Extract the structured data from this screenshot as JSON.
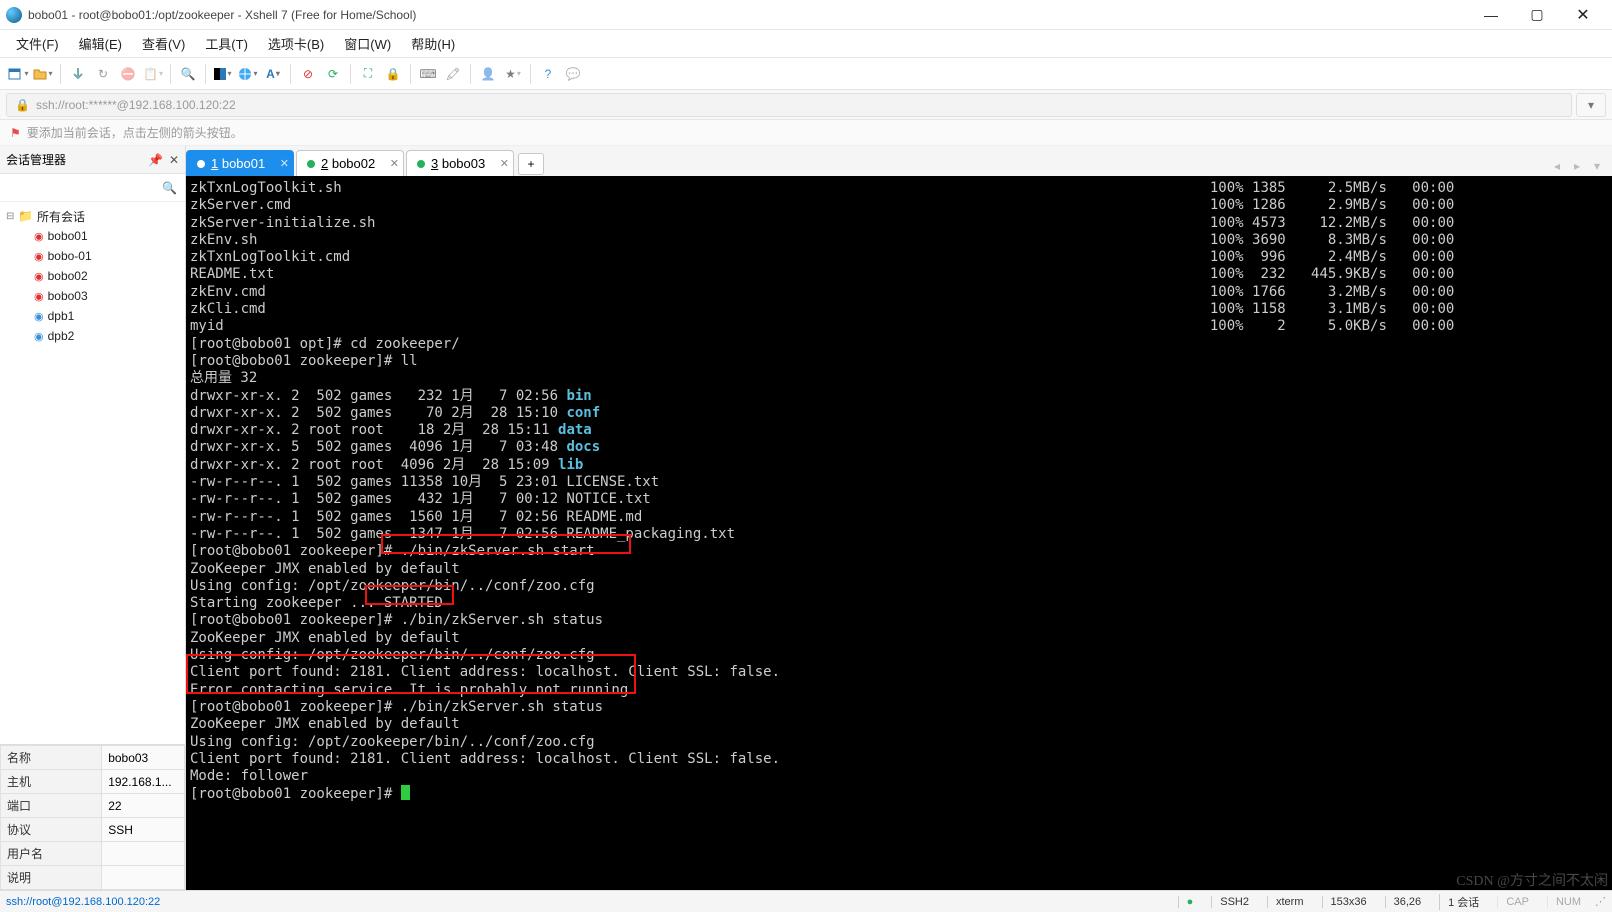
{
  "window": {
    "title": "bobo01 - root@bobo01:/opt/zookeeper - Xshell 7 (Free for Home/School)"
  },
  "menu": {
    "items": [
      "文件(F)",
      "编辑(E)",
      "查看(V)",
      "工具(T)",
      "选项卡(B)",
      "窗口(W)",
      "帮助(H)"
    ]
  },
  "address": {
    "url": "ssh://root:******@192.168.100.120:22"
  },
  "hint": {
    "text": "要添加当前会话，点击左侧的箭头按钮。"
  },
  "sidebar": {
    "title": "会话管理器",
    "root": "所有会话",
    "sessions": [
      {
        "name": "bobo01",
        "color": "red"
      },
      {
        "name": "bobo-01",
        "color": "red"
      },
      {
        "name": "bobo02",
        "color": "red"
      },
      {
        "name": "bobo03",
        "color": "red"
      },
      {
        "name": "dpb1",
        "color": "blue"
      },
      {
        "name": "dpb2",
        "color": "blue"
      }
    ]
  },
  "props": {
    "rows": [
      {
        "k": "名称",
        "v": "bobo03"
      },
      {
        "k": "主机",
        "v": "192.168.1..."
      },
      {
        "k": "端口",
        "v": "22"
      },
      {
        "k": "协议",
        "v": "SSH"
      },
      {
        "k": "用户名",
        "v": ""
      },
      {
        "k": "说明",
        "v": ""
      }
    ]
  },
  "tabs": {
    "items": [
      {
        "label": "1 bobo01",
        "active": true
      },
      {
        "label": "2 bobo02",
        "active": false
      },
      {
        "label": "3 bobo03",
        "active": false
      }
    ]
  },
  "terminal": {
    "transfer": [
      {
        "name": "zkTxnLogToolkit.sh",
        "pct": "100%",
        "size": "1385",
        "speed": "2.5MB/s",
        "eta": "00:00"
      },
      {
        "name": "zkServer.cmd",
        "pct": "100%",
        "size": "1286",
        "speed": "2.9MB/s",
        "eta": "00:00"
      },
      {
        "name": "zkServer-initialize.sh",
        "pct": "100%",
        "size": "4573",
        "speed": "12.2MB/s",
        "eta": "00:00"
      },
      {
        "name": "zkEnv.sh",
        "pct": "100%",
        "size": "3690",
        "speed": "8.3MB/s",
        "eta": "00:00"
      },
      {
        "name": "zkTxnLogToolkit.cmd",
        "pct": "100%",
        "size": "996",
        "speed": "2.4MB/s",
        "eta": "00:00"
      },
      {
        "name": "README.txt",
        "pct": "100%",
        "size": "232",
        "speed": "445.9KB/s",
        "eta": "00:00"
      },
      {
        "name": "zkEnv.cmd",
        "pct": "100%",
        "size": "1766",
        "speed": "3.2MB/s",
        "eta": "00:00"
      },
      {
        "name": "zkCli.cmd",
        "pct": "100%",
        "size": "1158",
        "speed": "3.1MB/s",
        "eta": "00:00"
      },
      {
        "name": "myid",
        "pct": "100%",
        "size": "2",
        "speed": "5.0KB/s",
        "eta": "00:00"
      }
    ],
    "body": [
      "[root@bobo01 opt]# cd zookeeper/",
      "[root@bobo01 zookeeper]# ll",
      "总用量 32",
      {
        "text": "drwxr-xr-x. 2  502 games   232 1月   7 02:56 ",
        "dir": "bin"
      },
      {
        "text": "drwxr-xr-x. 2  502 games    70 2月  28 15:10 ",
        "dir": "conf"
      },
      {
        "text": "drwxr-xr-x. 2 root root    18 2月  28 15:11 ",
        "dir": "data"
      },
      {
        "text": "drwxr-xr-x. 5  502 games  4096 1月   7 03:48 ",
        "dir": "docs"
      },
      {
        "text": "drwxr-xr-x. 2 root root  4096 2月  28 15:09 ",
        "dir": "lib"
      },
      "-rw-r--r--. 1  502 games 11358 10月  5 23:01 LICENSE.txt",
      "-rw-r--r--. 1  502 games   432 1月   7 00:12 NOTICE.txt",
      "-rw-r--r--. 1  502 games  1560 1月   7 02:56 README.md",
      "-rw-r--r--. 1  502 games  1347 1月   7 02:56 README_packaging.txt",
      "[root@bobo01 zookeeper]# ./bin/zkServer.sh start",
      "ZooKeeper JMX enabled by default",
      "Using config: /opt/zookeeper/bin/../conf/zoo.cfg",
      "Starting zookeeper ... STARTED",
      "[root@bobo01 zookeeper]# ./bin/zkServer.sh status",
      "ZooKeeper JMX enabled by default",
      "Using config: /opt/zookeeper/bin/../conf/zoo.cfg",
      "Client port found: 2181. Client address: localhost. Client SSL: false.",
      "Error contacting service. It is probably not running.",
      "[root@bobo01 zookeeper]# ./bin/zkServer.sh status",
      "ZooKeeper JMX enabled by default",
      "Using config: /opt/zookeeper/bin/../conf/zoo.cfg",
      "Client port found: 2181. Client address: localhost. Client SSL: false.",
      "Mode: follower",
      "[root@bobo01 zookeeper]# "
    ]
  },
  "status": {
    "path": "ssh://root@192.168.100.120:22",
    "segs": [
      "SSH2",
      "xterm",
      "153x36",
      "36,26",
      "1 会话",
      "CAP",
      "NUM"
    ],
    "conn_dot": "●"
  },
  "watermark": "CSDN @方寸之间不太闲"
}
